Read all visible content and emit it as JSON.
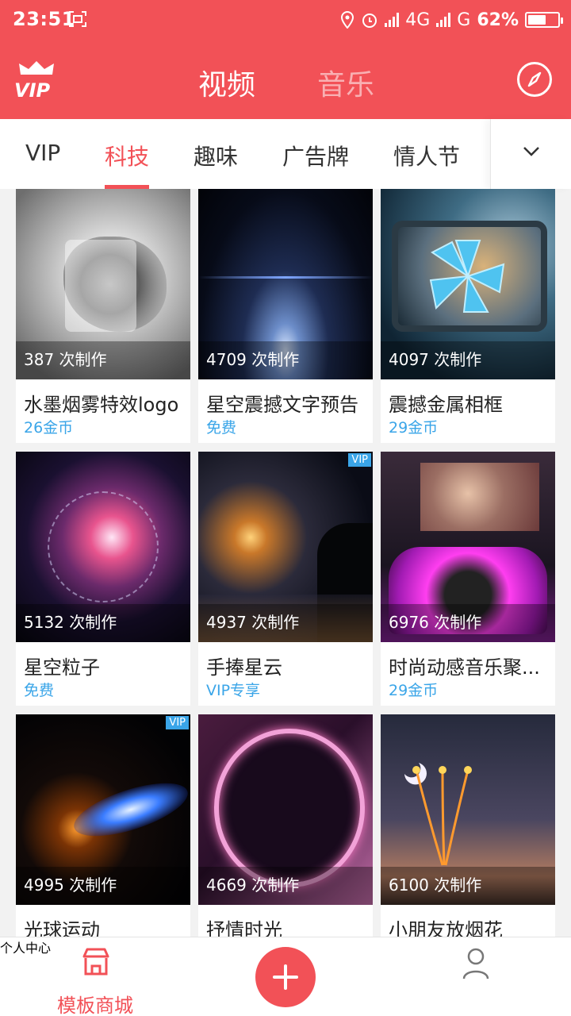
{
  "status_bar": {
    "time": "23:51",
    "network1": "4G",
    "network2": "G",
    "battery": "62%",
    "battery_level": 0.62
  },
  "header": {
    "logo": "VIP",
    "tabs": [
      {
        "label": "视频",
        "active": true
      },
      {
        "label": "音乐",
        "active": false
      }
    ],
    "right_icon": "compass-icon"
  },
  "categories": {
    "items": [
      "VIP",
      "科技",
      "趣味",
      "广告牌",
      "情人节"
    ],
    "active_index": 1,
    "more_icon": "chevron-down-icon"
  },
  "colors": {
    "accent": "#f25157",
    "price_blue": "#3aa5e8"
  },
  "templates": [
    {
      "count": "387 次制作",
      "title": "水墨烟雾特效logo",
      "price": "26金币",
      "vip": false
    },
    {
      "count": "4709 次制作",
      "title": "星空震撼文字预告",
      "price": "免费",
      "vip": false
    },
    {
      "count": "4097 次制作",
      "title": "震撼金属相框",
      "price": "29金币",
      "vip": false
    },
    {
      "count": "5132 次制作",
      "title": "星空粒子",
      "price": "免费",
      "vip": false
    },
    {
      "count": "4937 次制作",
      "title": "手捧星云",
      "price": "VIP专享",
      "vip": true
    },
    {
      "count": "6976 次制作",
      "title": "时尚动感音乐聚...",
      "price": "29金币",
      "vip": false
    },
    {
      "count": "4995 次制作",
      "title": "光球运动",
      "price": "",
      "vip": true
    },
    {
      "count": "4669 次制作",
      "title": "抒情时光",
      "price": "",
      "vip": false
    },
    {
      "count": "6100 次制作",
      "title": "小朋友放烟花",
      "price": "",
      "vip": false
    }
  ],
  "vip_badge": "VIP",
  "bottom_nav": {
    "store_label": "模板商城",
    "me_label": "个人中心",
    "add_icon": "plus-icon"
  }
}
